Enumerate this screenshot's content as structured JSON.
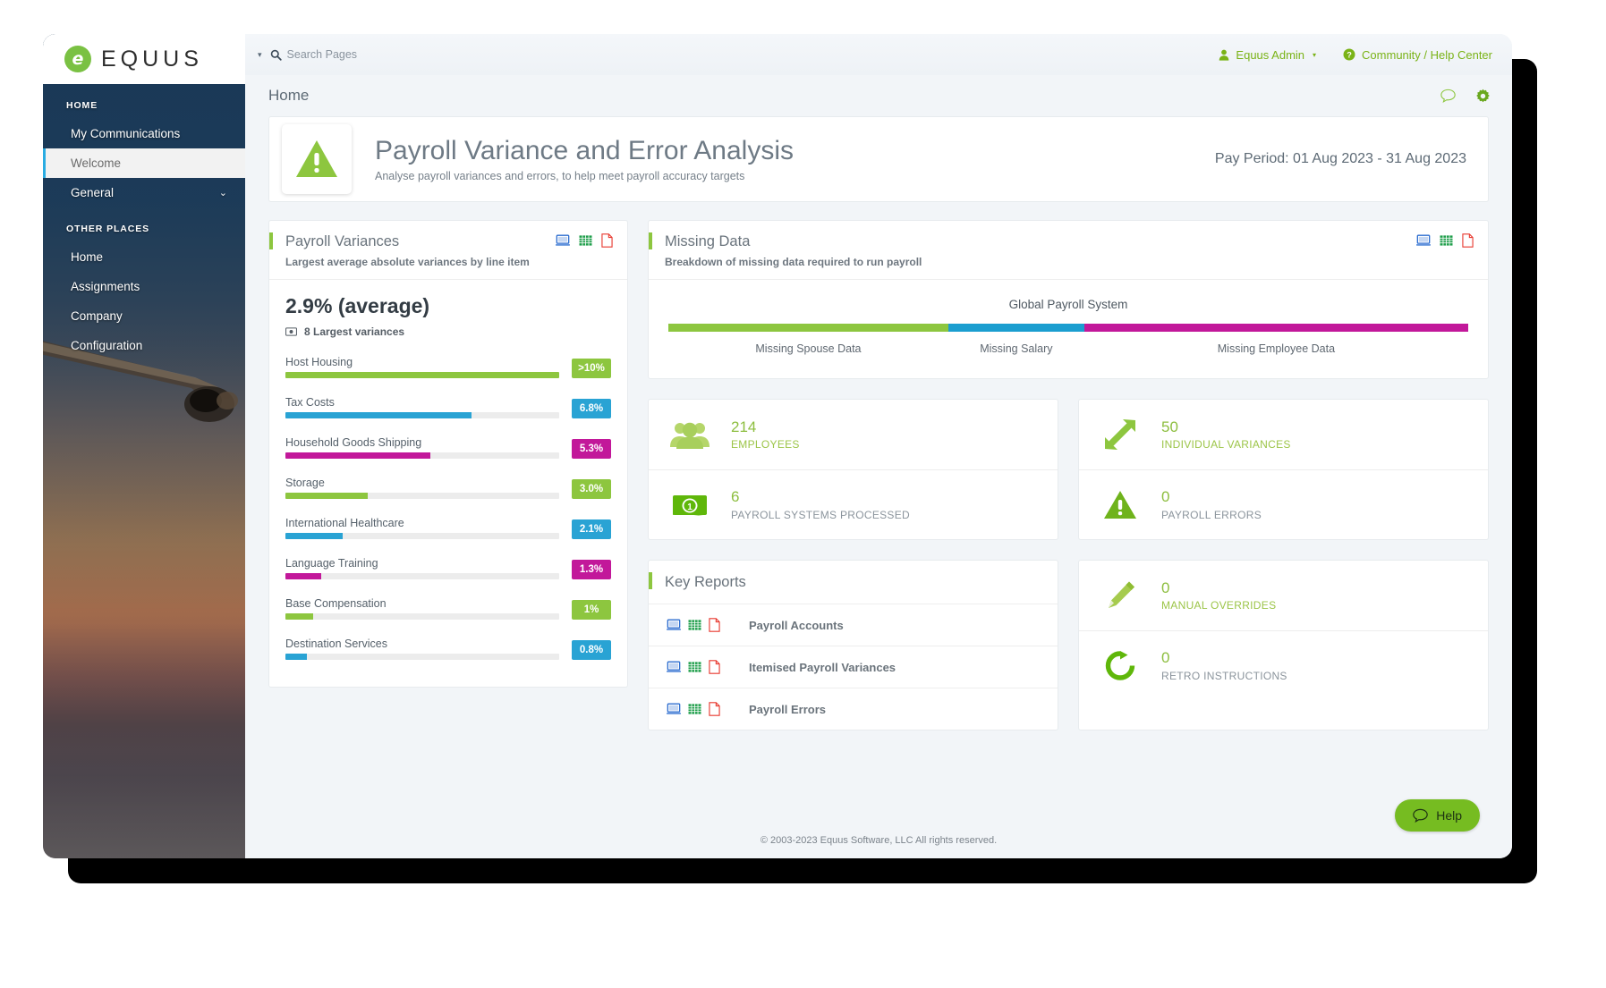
{
  "brand": {
    "name": "EQUUS",
    "mark_letter": "e",
    "mark_color": "#7ac143"
  },
  "sidebar": {
    "sections": [
      {
        "label": "HOME",
        "items": [
          {
            "label": "My Communications",
            "active": false,
            "caret": ""
          },
          {
            "label": "Welcome",
            "active": true,
            "caret": ""
          },
          {
            "label": "General",
            "active": false,
            "caret": "⌄"
          }
        ]
      },
      {
        "label": "OTHER PLACES",
        "items": [
          {
            "label": "Home",
            "active": false,
            "caret": ""
          },
          {
            "label": "Assignments",
            "active": false,
            "caret": ""
          },
          {
            "label": "Company",
            "active": false,
            "caret": ""
          },
          {
            "label": "Configuration",
            "active": false,
            "caret": ""
          }
        ]
      }
    ]
  },
  "topbar": {
    "caret": "▾",
    "search_icon": "search-icon",
    "search_placeholder": "Search Pages",
    "user": {
      "label": "Equus Admin",
      "icon": "user-icon",
      "caret": "▾"
    },
    "help": {
      "label": "Community / Help Center",
      "icon": "question-circle-icon"
    }
  },
  "breadcrumb": {
    "label": "Home",
    "icons": [
      "comment-icon",
      "gear-icon"
    ]
  },
  "page_header": {
    "icon": "warning-triangle-icon",
    "title": "Payroll Variance and Error Analysis",
    "subtitle": "Analyse payroll variances and errors, to help meet payroll accuracy targets",
    "pay_period": "Pay Period: 01 Aug 2023 - 31 Aug 2023"
  },
  "payroll_variances": {
    "title": "Payroll Variances",
    "subtitle": "Largest average absolute variances by line item",
    "export_icons": [
      "dashboard-icon",
      "excel-icon",
      "pdf-icon"
    ],
    "average_value": "2.9% (average)",
    "count_icon": "money-icon",
    "count_label": "8 Largest variances"
  },
  "missing_data": {
    "title": "Missing Data",
    "subtitle": "Breakdown of missing data required to run payroll",
    "export_icons": [
      "dashboard-icon",
      "excel-icon",
      "pdf-icon"
    ],
    "system_label": "Global Payroll System"
  },
  "stats": {
    "left": [
      {
        "icon": "people-icon",
        "value": "214",
        "label": "EMPLOYEES",
        "label_tone": "green"
      },
      {
        "icon": "money-note-icon",
        "value": "6",
        "label": "PAYROLL SYSTEMS PROCESSED",
        "label_tone": "gray"
      }
    ],
    "right_top": [
      {
        "icon": "expand-arrows-icon",
        "value": "50",
        "label": "INDIVIDUAL VARIANCES",
        "label_tone": "green"
      },
      {
        "icon": "warning-triangle-icon",
        "value": "0",
        "label": "PAYROLL ERRORS",
        "label_tone": "gray"
      }
    ],
    "right_bottom": [
      {
        "icon": "pencil-icon",
        "value": "0",
        "label": "MANUAL OVERRIDES",
        "label_tone": "green"
      },
      {
        "icon": "refresh-icon",
        "value": "0",
        "label": "RETRO INSTRUCTIONS",
        "label_tone": "gray"
      }
    ]
  },
  "key_reports": {
    "title": "Key Reports",
    "rows": [
      {
        "label": "Payroll Accounts",
        "icons": [
          "dashboard-icon",
          "excel-icon",
          "pdf-icon"
        ]
      },
      {
        "label": "Itemised Payroll Variances",
        "icons": [
          "dashboard-icon",
          "excel-icon",
          "pdf-icon"
        ]
      },
      {
        "label": "Payroll Errors",
        "icons": [
          "dashboard-icon",
          "excel-icon",
          "pdf-icon"
        ]
      }
    ]
  },
  "footer": {
    "text": "© 2003-2023 Equus Software, LLC All rights reserved."
  },
  "help_button": {
    "label": "Help",
    "icon": "comment-icon",
    "color": "#76bc21"
  },
  "palette": {
    "green": "#8dc63f",
    "blue": "#29a3d4",
    "magenta": "#c2189a",
    "accent_green": "#7ab317",
    "sidebar_dark": "#1d3a5c",
    "active_blue": "#2aace2"
  },
  "chart_data": [
    {
      "type": "bar",
      "title": "Payroll Variances",
      "subtitle": "Largest average absolute variances by line item",
      "orientation": "horizontal",
      "xlabel": "",
      "ylabel": "",
      "annotation": "2.9% (average)",
      "note": "8 Largest variances",
      "categories": [
        "Host Housing",
        "Tax Costs",
        "Household Goods Shipping",
        "Storage",
        "International Healthcare",
        "Language Training",
        "Base Compensation",
        "Destination Services"
      ],
      "values": [
        10,
        6.8,
        5.3,
        3.0,
        2.1,
        1.3,
        1.0,
        0.8
      ],
      "display_values": [
        ">10%",
        "6.8%",
        "5.3%",
        "3.0%",
        "2.1%",
        "1.3%",
        "1%",
        "0.8%"
      ],
      "bar_pct": [
        100,
        68,
        53,
        30,
        21,
        13,
        10,
        8
      ],
      "colors": [
        "#8dc63f",
        "#29a3d4",
        "#c2189a",
        "#8dc63f",
        "#29a3d4",
        "#c2189a",
        "#8dc63f",
        "#29a3d4"
      ],
      "ylim": [
        0,
        10
      ]
    },
    {
      "type": "bar",
      "title": "Missing Data",
      "subtitle": "Breakdown of missing data required to run payroll",
      "orientation": "stacked-horizontal",
      "group": "Global Payroll System",
      "categories": [
        "Missing Spouse Data",
        "Missing Salary",
        "Missing Employee Data"
      ],
      "values": [
        35,
        17,
        48
      ],
      "colors": [
        "#8dc63f",
        "#1b9ed0",
        "#c2189a"
      ],
      "ylim": [
        0,
        100
      ]
    }
  ]
}
